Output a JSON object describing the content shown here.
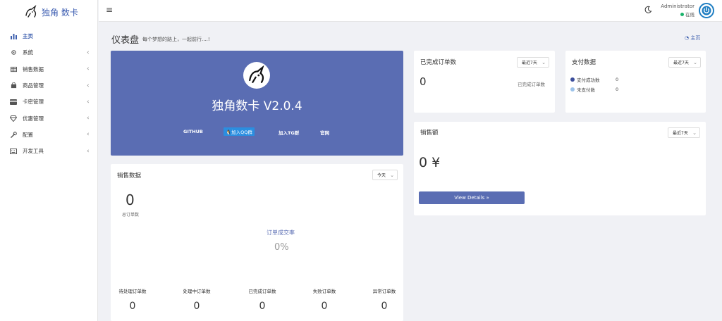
{
  "brand": {
    "name": "独角 数卡"
  },
  "sidebar": {
    "items": [
      {
        "label": "主页",
        "icon": "bar-chart-icon",
        "has_children": false
      },
      {
        "label": "系统",
        "icon": "gear-icon",
        "has_children": true
      },
      {
        "label": "销售数据",
        "icon": "table-icon",
        "has_children": true
      },
      {
        "label": "商品管理",
        "icon": "shopping-bag-icon",
        "has_children": true
      },
      {
        "label": "卡密管理",
        "icon": "credit-card-icon",
        "has_children": true
      },
      {
        "label": "优惠管理",
        "icon": "diamond-icon",
        "has_children": true
      },
      {
        "label": "配置",
        "icon": "wrench-icon",
        "has_children": true
      },
      {
        "label": "开发工具",
        "icon": "keyboard-icon",
        "has_children": true
      }
    ],
    "chevron": "‹"
  },
  "header": {
    "menu_glyph": "≡",
    "user_name": "Administrator",
    "user_status": "在线"
  },
  "page": {
    "title": "仪表盘",
    "subtitle": "每个梦想的路上，一起前行....!",
    "home_link": "主页"
  },
  "hero": {
    "title": "独角数卡 V2.0.4",
    "links": {
      "github": "GITHUB",
      "qq": "加入QQ群",
      "tg": "加入TG群",
      "official": "官网"
    }
  },
  "completed_orders": {
    "title": "已完成订单数",
    "range": "最近7天",
    "value": "0",
    "caption": "已完成订单数"
  },
  "payment_data": {
    "title": "支付数据",
    "range": "最近7天",
    "items": [
      {
        "label": "支付成功数",
        "value": "0",
        "color": "#3d4f9c"
      },
      {
        "label": "未支付数",
        "value": "0",
        "color": "#9dc3ea"
      }
    ]
  },
  "sales_amount": {
    "title": "销售额",
    "range": "最近7天",
    "value": "0 ¥",
    "button": "View Details »"
  },
  "sales_data": {
    "title": "销售数据",
    "range": "今天",
    "total": "0",
    "total_label": "总订单数",
    "rate_label": "订单成交率",
    "rate_value": "0%",
    "stats": [
      {
        "label": "待处理订单数",
        "value": "0"
      },
      {
        "label": "处理中订单数",
        "value": "0"
      },
      {
        "label": "已完成订单数",
        "value": "0"
      },
      {
        "label": "失败订单数",
        "value": "0"
      },
      {
        "label": "异常订单数",
        "value": "0"
      }
    ]
  },
  "colors": {
    "accent": "#5a6db3",
    "online": "#1ab36b",
    "brand_text": "#3a5bb0"
  }
}
